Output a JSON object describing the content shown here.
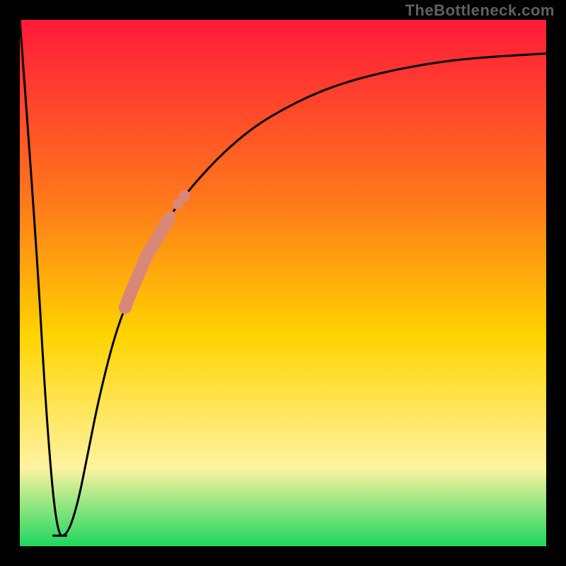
{
  "watermark": "TheBottleneck.com",
  "colors": {
    "frame": "#000000",
    "curve": "#000000",
    "highlight": "#d88878",
    "grad_top": "#ff1a3a",
    "grad_upper": "#ff7a1a",
    "grad_mid": "#ffd400",
    "grad_lower": "#fff3a0",
    "grad_bottom": "#1ed760"
  },
  "chart_data": {
    "type": "line",
    "title": "",
    "xlabel": "",
    "ylabel": "",
    "xlim": [
      0,
      100
    ],
    "ylim": [
      0,
      100
    ],
    "x": [
      0,
      3,
      5,
      7,
      9,
      11,
      13,
      15,
      18,
      21,
      24,
      27,
      30,
      35,
      40,
      45,
      50,
      55,
      60,
      65,
      70,
      75,
      80,
      85,
      90,
      95,
      100
    ],
    "values": [
      100,
      60,
      25,
      2,
      2,
      8,
      18,
      28,
      40,
      48,
      55,
      60,
      65,
      71,
      76,
      80,
      83,
      85.5,
      87.5,
      89,
      90.2,
      91.2,
      92,
      92.6,
      93,
      93.3,
      93.6
    ],
    "flat_bottom": {
      "x_start": 6.2,
      "x_end": 9.0,
      "y": 2
    },
    "highlight_segment": {
      "x_start": 20,
      "x_end": 28
    },
    "highlight_dots_x": [
      28.6,
      30.0,
      31.3
    ]
  }
}
